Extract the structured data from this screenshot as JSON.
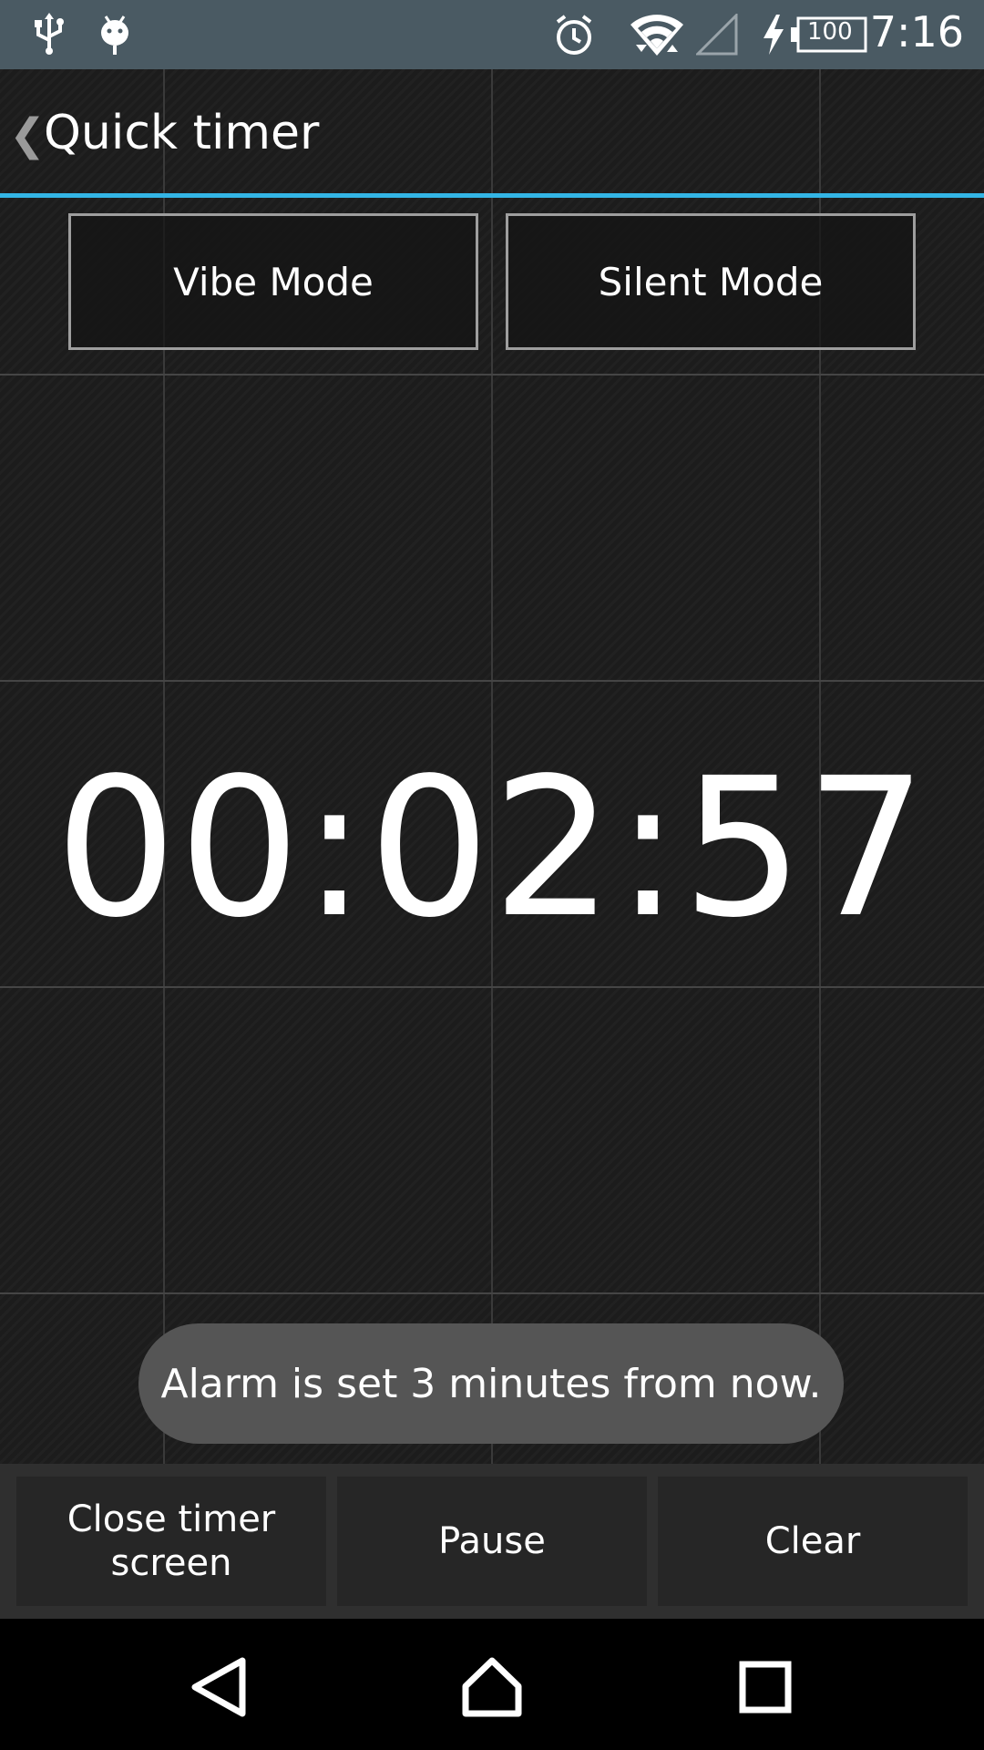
{
  "status_bar": {
    "time": "7:16",
    "battery_level": "100",
    "icons": [
      "usb-icon",
      "android-debug-icon",
      "alarm-icon",
      "wifi-icon",
      "cell-signal-icon",
      "charging-icon",
      "battery-icon"
    ]
  },
  "action_bar": {
    "title": "Quick timer",
    "back_glyph": "❮"
  },
  "mode_buttons": {
    "vibe_label": "Vibe Mode",
    "silent_label": "Silent Mode"
  },
  "timer": {
    "display": "00:02:57"
  },
  "toast": {
    "message": "Alarm is set 3 minutes from now."
  },
  "bottom_buttons": {
    "close_line1": "Close timer",
    "close_line2": "screen",
    "pause_label": "Pause",
    "clear_label": "Clear"
  },
  "nav_bar": {
    "icons": [
      "back-icon",
      "home-icon",
      "recents-icon"
    ]
  },
  "colors": {
    "accent": "#33b5e5",
    "status_bar": "#4a5a63",
    "background": "#1c1c1c",
    "toast": "#555555"
  }
}
